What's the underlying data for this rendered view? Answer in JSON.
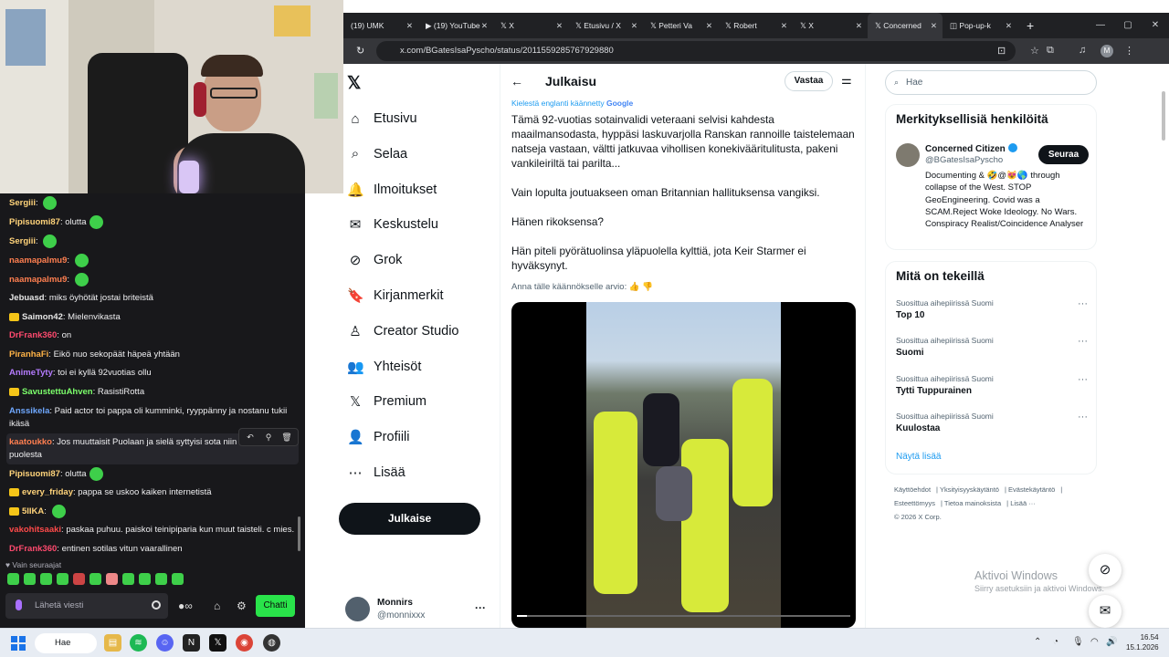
{
  "chat": {
    "messages": [
      {
        "user": "Sergiii",
        "color": "#ffd37a",
        "text": "",
        "emote": true,
        "badge": false
      },
      {
        "user": "Pipisuomi87",
        "color": "#ffd37a",
        "text": "olutta",
        "emote": true,
        "badge": false
      },
      {
        "user": "Sergiii",
        "color": "#ffd37a",
        "text": "",
        "emote": true,
        "badge": false
      },
      {
        "user": "naamapalmu9",
        "color": "#ff7f50",
        "text": "",
        "emote": true,
        "badge": false
      },
      {
        "user": "naamapalmu9",
        "color": "#ff7f50",
        "text": "",
        "emote": true,
        "badge": false
      },
      {
        "user": "Jebuasd",
        "color": "#e6e6e6",
        "text": "miks öyhötät jostai briteistä",
        "emote": false,
        "badge": false
      },
      {
        "user": "Saimon42",
        "color": "#e6e6e6",
        "text": "Mielenvikasta",
        "emote": false,
        "badge": true
      },
      {
        "user": "DrFrank360",
        "color": "#ff4a6e",
        "text": "on",
        "emote": false,
        "badge": false
      },
      {
        "user": "PiranhaFi",
        "color": "#ffb347",
        "text": "Eikö nuo sekopäät häpeä yhtään",
        "emote": false,
        "badge": false
      },
      {
        "user": "AnimeTyty",
        "color": "#b57bff",
        "text": "toi ei kyllä 92vuotias ollu",
        "emote": false,
        "badge": false
      },
      {
        "user": "SavustettuAhven",
        "color": "#7cff6b",
        "text": "RasistiRotta",
        "emote": false,
        "badge": true
      },
      {
        "user": "Anssikela",
        "color": "#6fa8ff",
        "text": "Paid actor toi pappa oli kumminki, ryyppänny ja nostanu tukii ikäsä",
        "emote": false,
        "badge": false
      },
      {
        "user": "kaatoukko",
        "color": "#ff7f50",
        "text": "Jos muuttaisit Puolaan ja sielä syttyisi sota niin soitlaite Puolan puolesta",
        "emote": false,
        "badge": false,
        "hl": true
      },
      {
        "user": "Pipisuomi87",
        "color": "#ffd37a",
        "text": "olutta",
        "emote": true,
        "badge": false
      },
      {
        "user": "every_friday",
        "color": "#ffd37a",
        "text": "pappa se uskoo kaiken internetistä",
        "emote": false,
        "badge": true
      },
      {
        "user": "5IIKA",
        "color": "#ffd37a",
        "text": "",
        "emote": true,
        "badge": true
      },
      {
        "user": "vakohitsaaki",
        "color": "#ff4a4a",
        "text": "paskaa puhuu. paiskoi teinipiparia kun muut taisteli. c mies.",
        "emote": false,
        "badge": false
      },
      {
        "user": "DrFrank360",
        "color": "#ff4a6e",
        "text": "entinen sotilas vitun vaarallinen",
        "emote": false,
        "badge": false
      }
    ],
    "followers_only": "Vain seuraajat",
    "input_placeholder": "Lähetä viesti",
    "send_label": "Chatti"
  },
  "browser": {
    "tabs": [
      {
        "label": "(19) UMK",
        "icon": ""
      },
      {
        "label": "(19) YouTube",
        "icon": "▶"
      },
      {
        "label": "X",
        "icon": "𝕏"
      },
      {
        "label": "Etusivu / X",
        "icon": "𝕏"
      },
      {
        "label": "Petteri Va",
        "icon": "𝕏"
      },
      {
        "label": "Robert",
        "icon": "𝕏"
      },
      {
        "label": "X",
        "icon": "𝕏"
      },
      {
        "label": "Concerned",
        "icon": "𝕏",
        "active": true
      },
      {
        "label": "Pop-up-k",
        "icon": "◫"
      }
    ],
    "url": "x.com/BGatesIsaPyscho/status/2011559285767929880"
  },
  "nav": {
    "items": [
      {
        "label": "Etusivu",
        "icon": "⌂"
      },
      {
        "label": "Selaa",
        "icon": "⌕"
      },
      {
        "label": "Ilmoitukset",
        "icon": "🔔"
      },
      {
        "label": "Keskustelu",
        "icon": "✉"
      },
      {
        "label": "Grok",
        "icon": "⊘"
      },
      {
        "label": "Kirjanmerkit",
        "icon": "🔖"
      },
      {
        "label": "Creator Studio",
        "icon": "♙"
      },
      {
        "label": "Yhteisöt",
        "icon": "👥"
      },
      {
        "label": "Premium",
        "icon": "𝕏"
      },
      {
        "label": "Profiili",
        "icon": "👤"
      },
      {
        "label": "Lisää",
        "icon": "⋯"
      }
    ],
    "post_button": "Julkaise",
    "account": {
      "name": "Monnirs",
      "handle": "@monnixxx"
    }
  },
  "post": {
    "title": "Julkaisu",
    "reply_button": "Vastaa",
    "translated_label": "Kielestä englanti käännetty",
    "google": "Google",
    "paragraphs": [
      "Tämä 92-vuotias sotainvalidi veteraani selvisi kahdesta maailmansodasta, hyppäsi laskuvarjolla Ranskan rannoille taistelemaan natseja vastaan, vältti jatkuvaa vihollisen konekivääritulitusta, pakeni vankileiriltä tai parilta...",
      "Vain lopulta joutuakseen oman Britannian hallituksensa vangiksi.",
      "Hänen rikoksensa?",
      "Hän piteli pyörätuolinsa yläpuolella kylttiä, jota Keir Starmer ei hyväksynyt."
    ],
    "rate_label": "Anna tälle käännökselle arvio:",
    "video_progress": 0.03
  },
  "sidebar": {
    "search_placeholder": "Hae",
    "relevant_title": "Merkityksellisiä henkilöitä",
    "user": {
      "name": "Concerned Citizen",
      "handle": "@BGatesIsaPyscho",
      "bio": "Documenting & 🤣@😻🌎 through collapse of the West. STOP GeoEngineering. Covid was a SCAM.Reject Woke Ideology. No Wars. Conspiracy Realist/Coincidence Analyser",
      "follow": "Seuraa"
    },
    "trending_title": "Mitä on tekeillä",
    "trends": [
      {
        "context": "Suosittua aihepiirissä Suomi",
        "name": "Top 10"
      },
      {
        "context": "Suosittua aihepiirissä Suomi",
        "name": "Suomi"
      },
      {
        "context": "Suosittua aihepiirissä Suomi",
        "name": "Tytti Tuppurainen"
      },
      {
        "context": "Suosittua aihepiirissä Suomi",
        "name": "Kuulostaa"
      }
    ],
    "show_more": "Näytä lisää",
    "legal": [
      "Käyttöehdot",
      "Yksityisyyskäytäntö",
      "Evästekäytäntö",
      "Esteettömyys",
      "Tietoa mainoksista",
      "Lisää ···",
      "© 2026 X Corp."
    ]
  },
  "watermark": {
    "title": "Aktivoi Windows",
    "subtitle": "Siirry asetuksiin ja aktivoi Windows."
  },
  "taskbar": {
    "search": "Hae",
    "time": "16.54",
    "date": "15.1.2026"
  }
}
